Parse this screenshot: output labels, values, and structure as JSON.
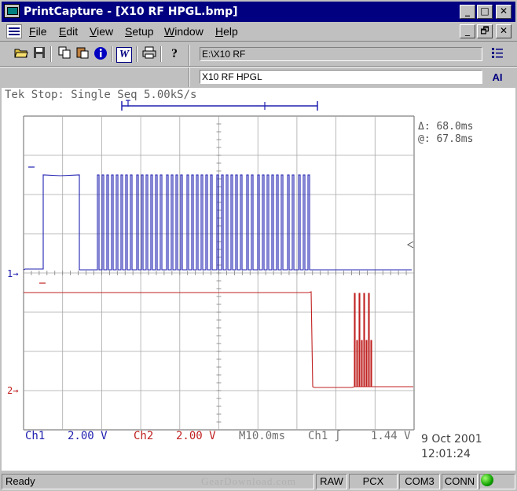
{
  "window": {
    "title": "PrintCapture - [X10 RF HPGL.bmp]",
    "minimize": "_",
    "maximize": "□",
    "close": "✕",
    "restore": "🗗"
  },
  "menu": {
    "items": [
      {
        "label": "File",
        "accel": "F",
        "rest": "ile"
      },
      {
        "label": "Edit",
        "accel": "E",
        "rest": "dit"
      },
      {
        "label": "View",
        "accel": "V",
        "rest": "iew"
      },
      {
        "label": "Setup",
        "accel": "S",
        "rest": "etup"
      },
      {
        "label": "Window",
        "accel": "W",
        "rest": "indow"
      },
      {
        "label": "Help",
        "accel": "H",
        "rest": "elp"
      }
    ]
  },
  "toolbar": {
    "path": "E:\\X10 RF",
    "name": "X10 RF HPGL",
    "ai_label": "AI"
  },
  "scope": {
    "header": "Tek Stop: Single Seq  5.00kS/s",
    "delta": "Δ: 68.0ms",
    "at": "@: 67.8ms",
    "ch1_marker": "1→",
    "ch2_marker": "2→",
    "ch1_label": "Ch1",
    "ch1_scale": "2.00 V",
    "ch2_label": "Ch2",
    "ch2_scale": "2.00 V",
    "timebase": "M10.0ms",
    "trigger": "Ch1 ∫",
    "trigger_level": "1.44 V",
    "date": "9 Oct 2001",
    "time": "12:01:24",
    "colors": {
      "ch1": "#2020b0",
      "ch2": "#c02020",
      "grid": "#a8a8a8"
    }
  },
  "status": {
    "ready": "Ready",
    "watermark": "GearDownload.com",
    "raw": "RAW",
    "pcx": "PCX",
    "com": "COM3",
    "conn": "CONN"
  }
}
